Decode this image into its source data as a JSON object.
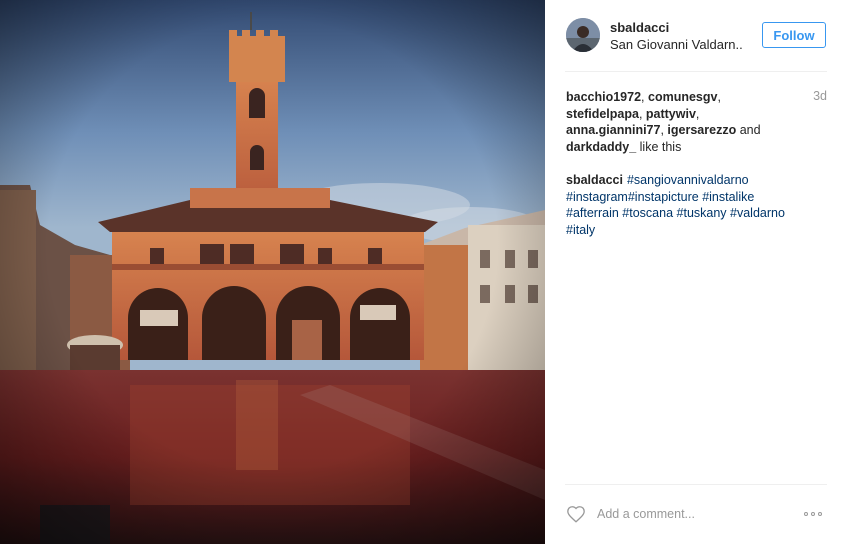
{
  "post": {
    "image_alt": "Palazzo d'Arnolfo, San Giovanni Valdarno, after rain",
    "header": {
      "username": "sbaldacci",
      "location": "San Giovanni Valdarn..",
      "follow_label": "Follow"
    },
    "likes": {
      "users": [
        "bacchio1972",
        "comunesgv",
        "stefidelpapa",
        "pattywiv",
        "anna.giannini77",
        "igersarezzo",
        "darkdaddy_"
      ],
      "and_text": "and",
      "suffix": "like this",
      "timestamp": "3d"
    },
    "caption": {
      "author": "sbaldacci",
      "hashtags": [
        "#sangiovannivaldarno",
        "#instagram",
        "#instapicture",
        "#instalike",
        "#afterrain",
        "#toscana",
        "#tuskany",
        "#valdarno",
        "#italy"
      ]
    },
    "comment": {
      "placeholder": "Add a comment..."
    },
    "icons": {
      "like": "heart-outline-icon",
      "more": "more-options-icon"
    },
    "colors": {
      "follow_blue": "#3897f0",
      "hashtag": "#003569",
      "muted": "#999999"
    }
  }
}
